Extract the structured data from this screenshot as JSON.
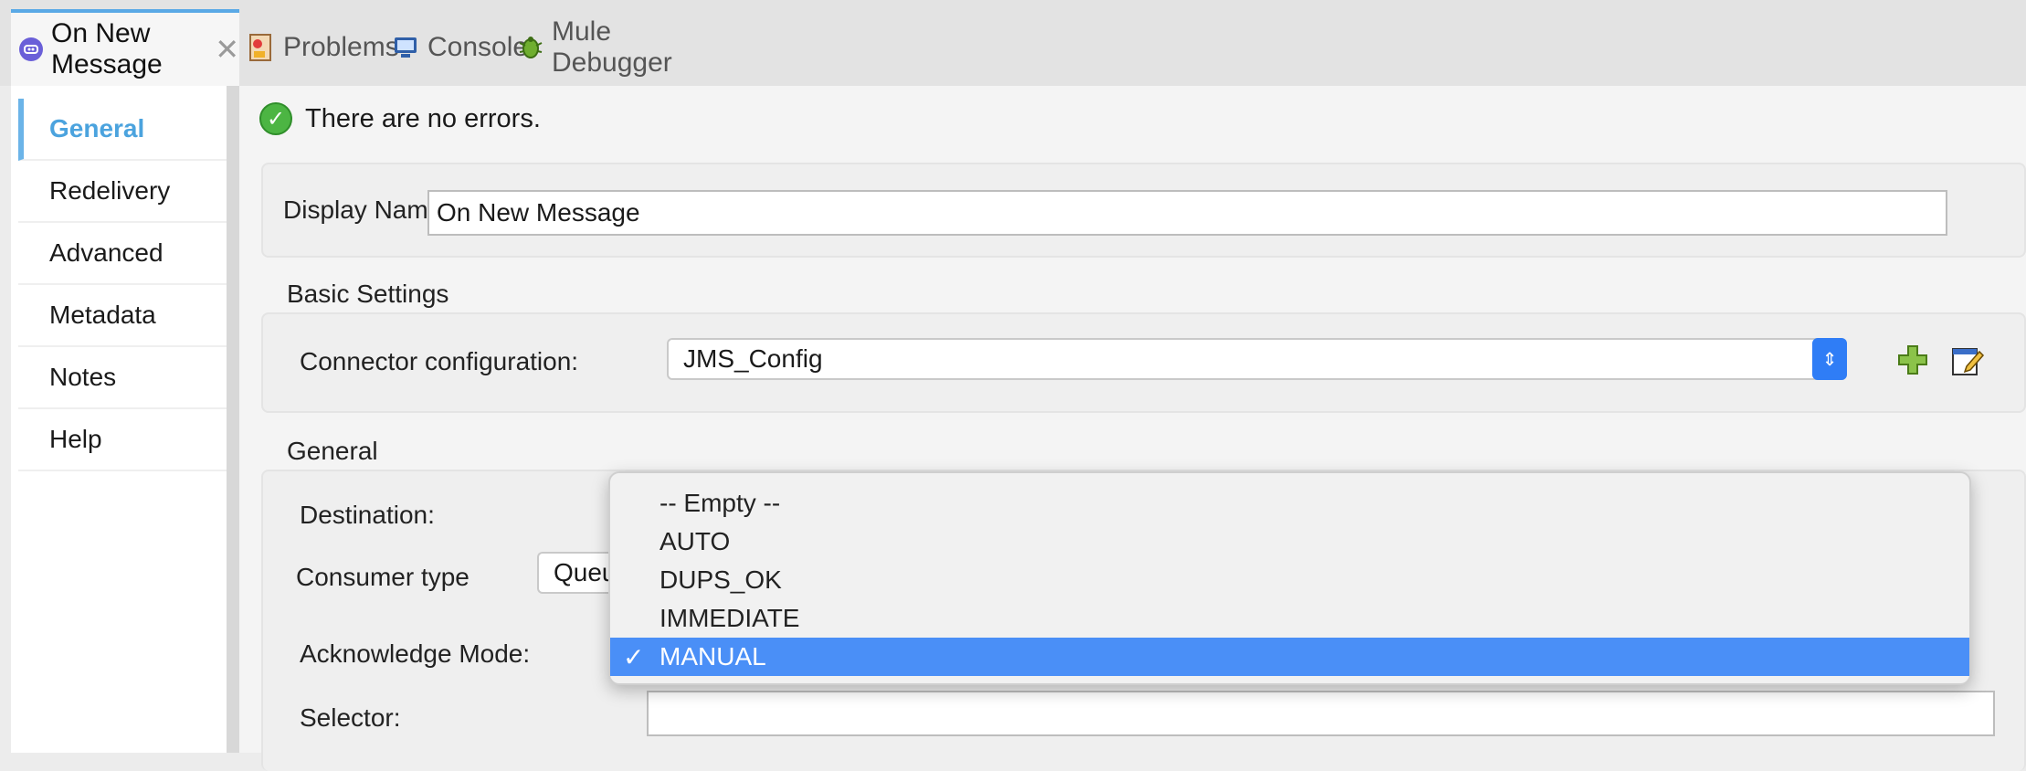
{
  "tabs": [
    {
      "label": "On New Message",
      "icon": "mule-event-icon",
      "active": true
    },
    {
      "label": "Problems",
      "icon": "problems-icon"
    },
    {
      "label": "Console",
      "icon": "console-icon"
    },
    {
      "label": "Mule Debugger",
      "icon": "bug-icon"
    }
  ],
  "sidebar": {
    "items": [
      {
        "label": "General",
        "active": true
      },
      {
        "label": "Redelivery"
      },
      {
        "label": "Advanced"
      },
      {
        "label": "Metadata"
      },
      {
        "label": "Notes"
      },
      {
        "label": "Help"
      }
    ]
  },
  "status": {
    "text": "There are no errors."
  },
  "display_name": {
    "label": "Display Name:",
    "value": "On New Message"
  },
  "basic_settings": {
    "title": "Basic Settings",
    "connector_label": "Connector configuration:",
    "connector_value": "JMS_Config"
  },
  "general": {
    "title": "General",
    "destination_label": "Destination:",
    "consumer_type_label": "Consumer type",
    "consumer_type_value": "Queu",
    "ack_mode_label": "Acknowledge Mode:",
    "selector_label": "Selector:"
  },
  "dropdown": {
    "options": [
      "-- Empty --",
      "AUTO",
      "DUPS_OK",
      "IMMEDIATE",
      "MANUAL"
    ],
    "selected": "MANUAL",
    "check": "✓"
  },
  "colors": {
    "accent": "#4ba3de",
    "selection": "#4a8ff7",
    "ok": "#4cb543"
  }
}
